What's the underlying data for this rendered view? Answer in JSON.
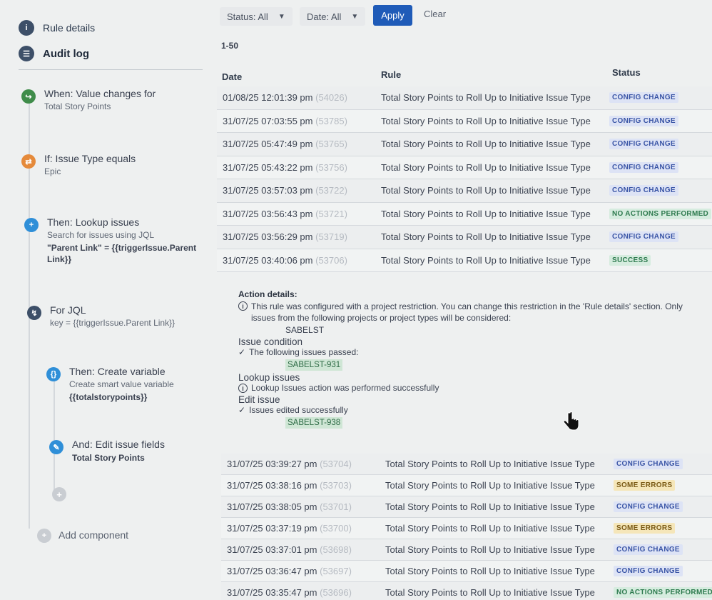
{
  "sidebar": {
    "nav": [
      {
        "label": "Rule details",
        "icon": "info-icon"
      },
      {
        "label": "Audit log",
        "icon": "list-icon"
      }
    ],
    "components": [
      {
        "title": "When: Value changes for",
        "subtitle": "Total Story Points",
        "bold": "",
        "color": "#3f8c4a",
        "icon": "trigger-icon"
      },
      {
        "title": "If: Issue Type equals",
        "subtitle": "Epic",
        "bold": "",
        "color": "#e58a3b",
        "icon": "condition-icon"
      },
      {
        "title": "Then: Lookup issues",
        "subtitle": "Search for issues using JQL",
        "bold": "\"Parent Link\" = {{triggerIssue.Parent Link}}",
        "color": "#2f8fd8",
        "icon": "plus-icon"
      },
      {
        "title": "For JQL",
        "subtitle": "key = {{triggerIssue.Parent Link}}",
        "bold": "",
        "color": "#3d4f68",
        "icon": "branch-icon"
      },
      {
        "title": "Then: Create variable",
        "subtitle": "Create smart value variable",
        "bold": "{{totalstorypoints}}",
        "color": "#2f8fd8",
        "icon": "braces-icon"
      },
      {
        "title": "And: Edit issue fields",
        "subtitle": "",
        "bold": "Total Story Points",
        "color": "#2f8fd8",
        "icon": "pencil-icon"
      }
    ],
    "add_component": "Add component"
  },
  "filters": {
    "status": "Status: All",
    "date": "Date: All",
    "apply": "Apply",
    "clear": "Clear"
  },
  "range": "1-50",
  "table": {
    "headers": {
      "date": "Date",
      "rule": "Rule",
      "status": "Status"
    },
    "rows_top": [
      {
        "date": "01/08/25 12:01:39 pm",
        "id": "(54026)",
        "rule": "Total Story Points to Roll Up to Initiative Issue Type",
        "status": "CONFIG CHANGE",
        "kind": "config"
      },
      {
        "date": "31/07/25 07:03:55 pm",
        "id": "(53785)",
        "rule": "Total Story Points to Roll Up to Initiative Issue Type",
        "status": "CONFIG CHANGE",
        "kind": "config"
      },
      {
        "date": "31/07/25 05:47:49 pm",
        "id": "(53765)",
        "rule": "Total Story Points to Roll Up to Initiative Issue Type",
        "status": "CONFIG CHANGE",
        "kind": "config"
      },
      {
        "date": "31/07/25 05:43:22 pm",
        "id": "(53756)",
        "rule": "Total Story Points to Roll Up to Initiative Issue Type",
        "status": "CONFIG CHANGE",
        "kind": "config"
      },
      {
        "date": "31/07/25 03:57:03 pm",
        "id": "(53722)",
        "rule": "Total Story Points to Roll Up to Initiative Issue Type",
        "status": "CONFIG CHANGE",
        "kind": "config"
      },
      {
        "date": "31/07/25 03:56:43 pm",
        "id": "(53721)",
        "rule": "Total Story Points to Roll Up to Initiative Issue Type",
        "status": "NO ACTIONS PERFORMED",
        "kind": "noact"
      },
      {
        "date": "31/07/25 03:56:29 pm",
        "id": "(53719)",
        "rule": "Total Story Points to Roll Up to Initiative Issue Type",
        "status": "CONFIG CHANGE",
        "kind": "config"
      },
      {
        "date": "31/07/25 03:40:06 pm",
        "id": "(53706)",
        "rule": "Total Story Points to Roll Up to Initiative Issue Type",
        "status": "SUCCESS",
        "kind": "success"
      }
    ],
    "rows_bottom": [
      {
        "date": "31/07/25 03:39:27 pm",
        "id": "(53704)",
        "rule": "Total Story Points to Roll Up to Initiative Issue Type",
        "status": "CONFIG CHANGE",
        "kind": "config"
      },
      {
        "date": "31/07/25 03:38:16 pm",
        "id": "(53703)",
        "rule": "Total Story Points to Roll Up to Initiative Issue Type",
        "status": "SOME ERRORS",
        "kind": "errors"
      },
      {
        "date": "31/07/25 03:38:05 pm",
        "id": "(53701)",
        "rule": "Total Story Points to Roll Up to Initiative Issue Type",
        "status": "CONFIG CHANGE",
        "kind": "config"
      },
      {
        "date": "31/07/25 03:37:19 pm",
        "id": "(53700)",
        "rule": "Total Story Points to Roll Up to Initiative Issue Type",
        "status": "SOME ERRORS",
        "kind": "errors"
      },
      {
        "date": "31/07/25 03:37:01 pm",
        "id": "(53698)",
        "rule": "Total Story Points to Roll Up to Initiative Issue Type",
        "status": "CONFIG CHANGE",
        "kind": "config"
      },
      {
        "date": "31/07/25 03:36:47 pm",
        "id": "(53697)",
        "rule": "Total Story Points to Roll Up to Initiative Issue Type",
        "status": "CONFIG CHANGE",
        "kind": "config"
      },
      {
        "date": "31/07/25 03:35:47 pm",
        "id": "(53696)",
        "rule": "Total Story Points to Roll Up to Initiative Issue Type",
        "status": "NO ACTIONS PERFORMED",
        "kind": "noact"
      }
    ]
  },
  "details": {
    "title": "Action details:",
    "restriction": "This rule was configured with a project restriction. You can change this restriction in the 'Rule details' section. Only issues from the following projects or project types will be considered:",
    "project": "SABELST",
    "condition_head": "Issue condition",
    "condition_msg": "The following issues passed:",
    "condition_issue": "SABELST-931",
    "lookup_head": "Lookup issues",
    "lookup_msg": "Lookup Issues action was performed successfully",
    "edit_head": "Edit issue",
    "edit_msg": "Issues edited successfully",
    "edit_issue": "SABELST-938"
  }
}
